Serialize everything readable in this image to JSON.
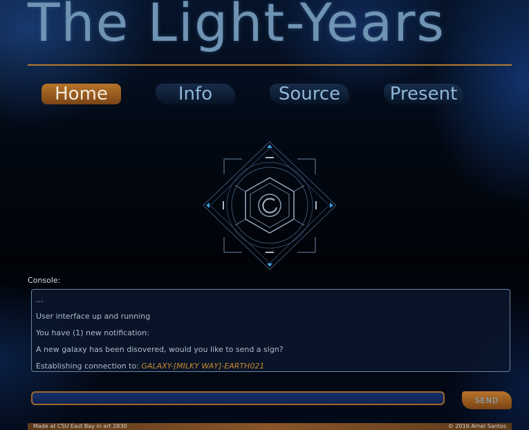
{
  "header": {
    "title": "The Light-Years"
  },
  "nav": {
    "items": [
      {
        "label": "Home",
        "active": true
      },
      {
        "label": "Info",
        "active": false
      },
      {
        "label": "Source",
        "active": false
      },
      {
        "label": "Present",
        "active": false
      }
    ]
  },
  "emblem": {
    "icon": "hexagon-target-emblem-icon"
  },
  "console": {
    "label": "Console:",
    "lines": [
      "...",
      "User interface up and running",
      "You have (1) new notification:",
      "A new galaxy has been disovered, would you like to send a sign?"
    ],
    "connection_prefix": "Establishing connection to: ",
    "connection_target": "GALAXY-[MILKY WAY]-EARTH021"
  },
  "input": {
    "value": "",
    "placeholder": ""
  },
  "send": {
    "label": "SEND"
  },
  "footer": {
    "left": "Made at CSU East Bay in art 2830",
    "right": "© 2016 Arnel Santos"
  },
  "colors": {
    "accent": "#b8742a",
    "title": "#6f93b3",
    "highlight": "#c98a2e"
  }
}
